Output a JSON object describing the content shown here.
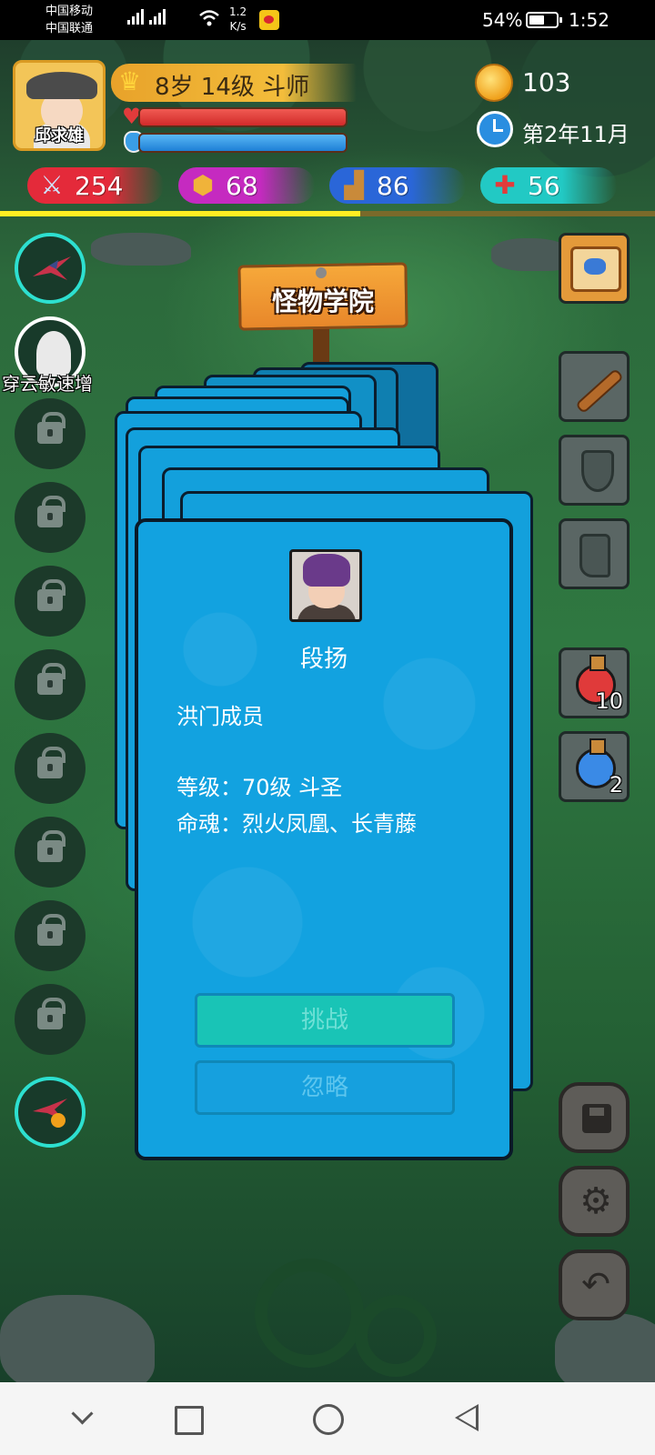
{
  "status_bar": {
    "carrier_1": "中国移动",
    "carrier_2": "中国联通",
    "network": "4G",
    "net_speed": "1.2",
    "net_speed_unit": "K/s",
    "battery": "54%",
    "time": "1:52"
  },
  "player": {
    "name": "邱求雄",
    "level": "8岁 14级 斗师",
    "hp_fraction": 1.0,
    "mp_fraction": 1.0,
    "xp_fraction": 0.55
  },
  "resources": {
    "coins": "103",
    "date": "第2年11月"
  },
  "stats": {
    "attack": "254",
    "defense": "68",
    "speed": "86",
    "health": "56"
  },
  "skills": {
    "active_caption": "穿云敏速增",
    "locked_count": 8
  },
  "scene": {
    "title": "怪物学院"
  },
  "card": {
    "npc_name": "段扬",
    "faction": "洪门成员",
    "level_line": "等级：70级 斗圣",
    "soul_line": "命魂：烈火凤凰、长青藤",
    "challenge_label": "挑战",
    "ignore_label": "忽略"
  },
  "inventory": {
    "red_potion_count": "10",
    "blue_potion_count": "2"
  },
  "colors": {
    "card_blue": "#12a2e0",
    "challenge_teal": "#19c4b6",
    "xp_yellow": "#ffee22",
    "skill_ring": "#2de0d0"
  }
}
